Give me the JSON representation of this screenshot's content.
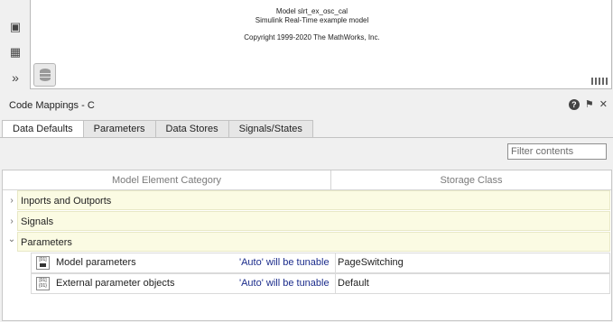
{
  "canvas": {
    "model_line": "Model slrt_ex_osc_cal",
    "subtitle": "Simulink Real-Time example model",
    "copyright": "Copyright 1999-2020 The MathWorks, Inc."
  },
  "panel": {
    "title": "Code Mappings - C",
    "help_glyph": "?",
    "pin_glyph": "⚑",
    "close_glyph": "✕"
  },
  "tabs": [
    {
      "label": "Data Defaults",
      "active": true
    },
    {
      "label": "Parameters",
      "active": false
    },
    {
      "label": "Data Stores",
      "active": false
    },
    {
      "label": "Signals/States",
      "active": false
    }
  ],
  "filter": {
    "placeholder": "Filter contents",
    "value": ""
  },
  "table": {
    "headers": {
      "category": "Model Element Category",
      "storage": "Storage Class"
    },
    "groups": [
      {
        "label": "Inports and Outports",
        "expanded": false,
        "chevron": "›"
      },
      {
        "label": "Signals",
        "expanded": false,
        "chevron": "›"
      },
      {
        "label": "Parameters",
        "expanded": true,
        "chevron": "⌄"
      }
    ],
    "rows": [
      {
        "name": "Model parameters",
        "hint": "'Auto' will be tunable",
        "storage": "PageSwitching",
        "icon": "model-parameter-icon"
      },
      {
        "name": "External parameter objects",
        "hint": "'Auto' will be tunable",
        "storage": "Default",
        "icon": "external-parameter-icon"
      }
    ]
  }
}
